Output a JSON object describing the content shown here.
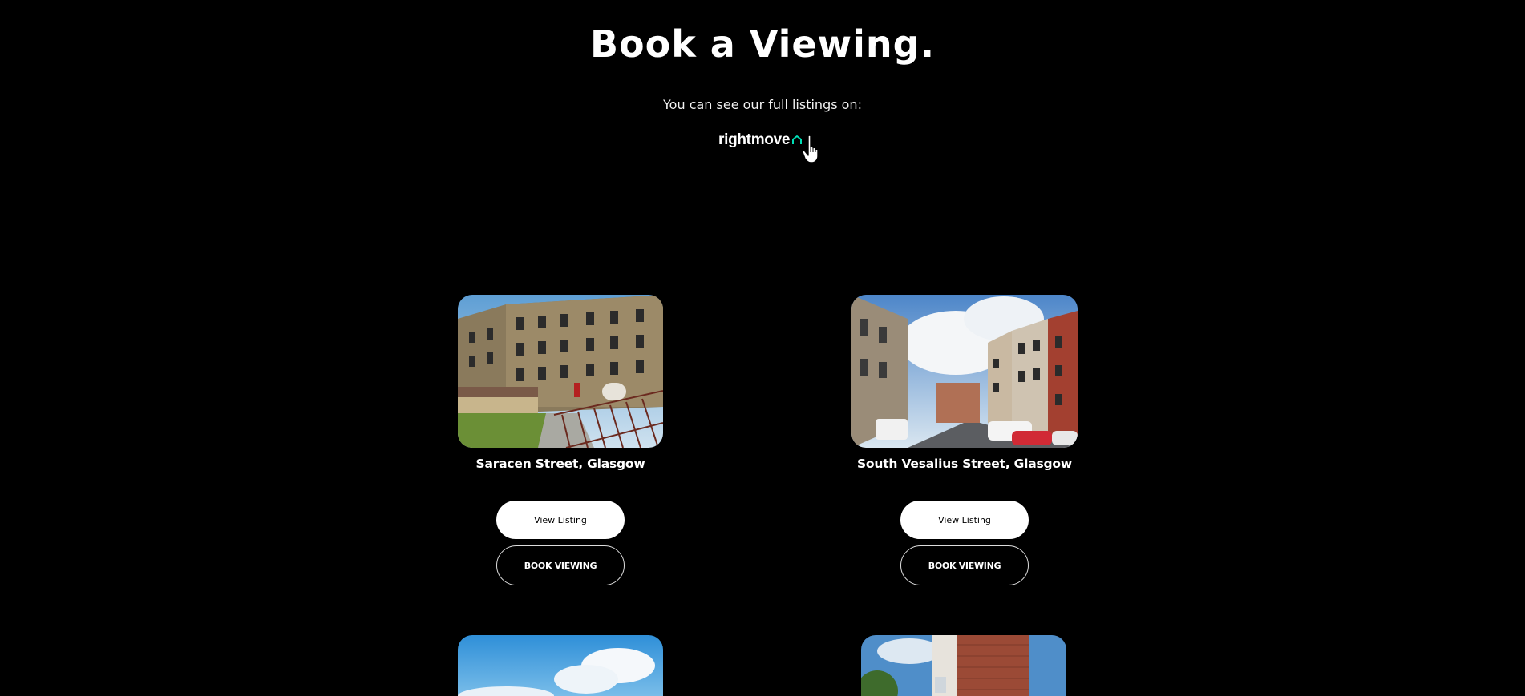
{
  "header": {
    "title": "Book a Viewing.",
    "subtitle": "You can see our full listings on:",
    "rightmove_label": "rightmove"
  },
  "colors": {
    "background": "#000000",
    "text": "#ffffff",
    "rightmove_accent": "#00deb6"
  },
  "listings": [
    {
      "name": "Saracen Street, Glasgow",
      "view_label": "View Listing",
      "book_label": "BOOK VIEWING"
    },
    {
      "name": "South Vesalius Street, Glasgow",
      "view_label": "View Listing",
      "book_label": "BOOK VIEWING"
    },
    {
      "name": "",
      "view_label": "",
      "book_label": ""
    },
    {
      "name": "",
      "view_label": "",
      "book_label": ""
    }
  ]
}
